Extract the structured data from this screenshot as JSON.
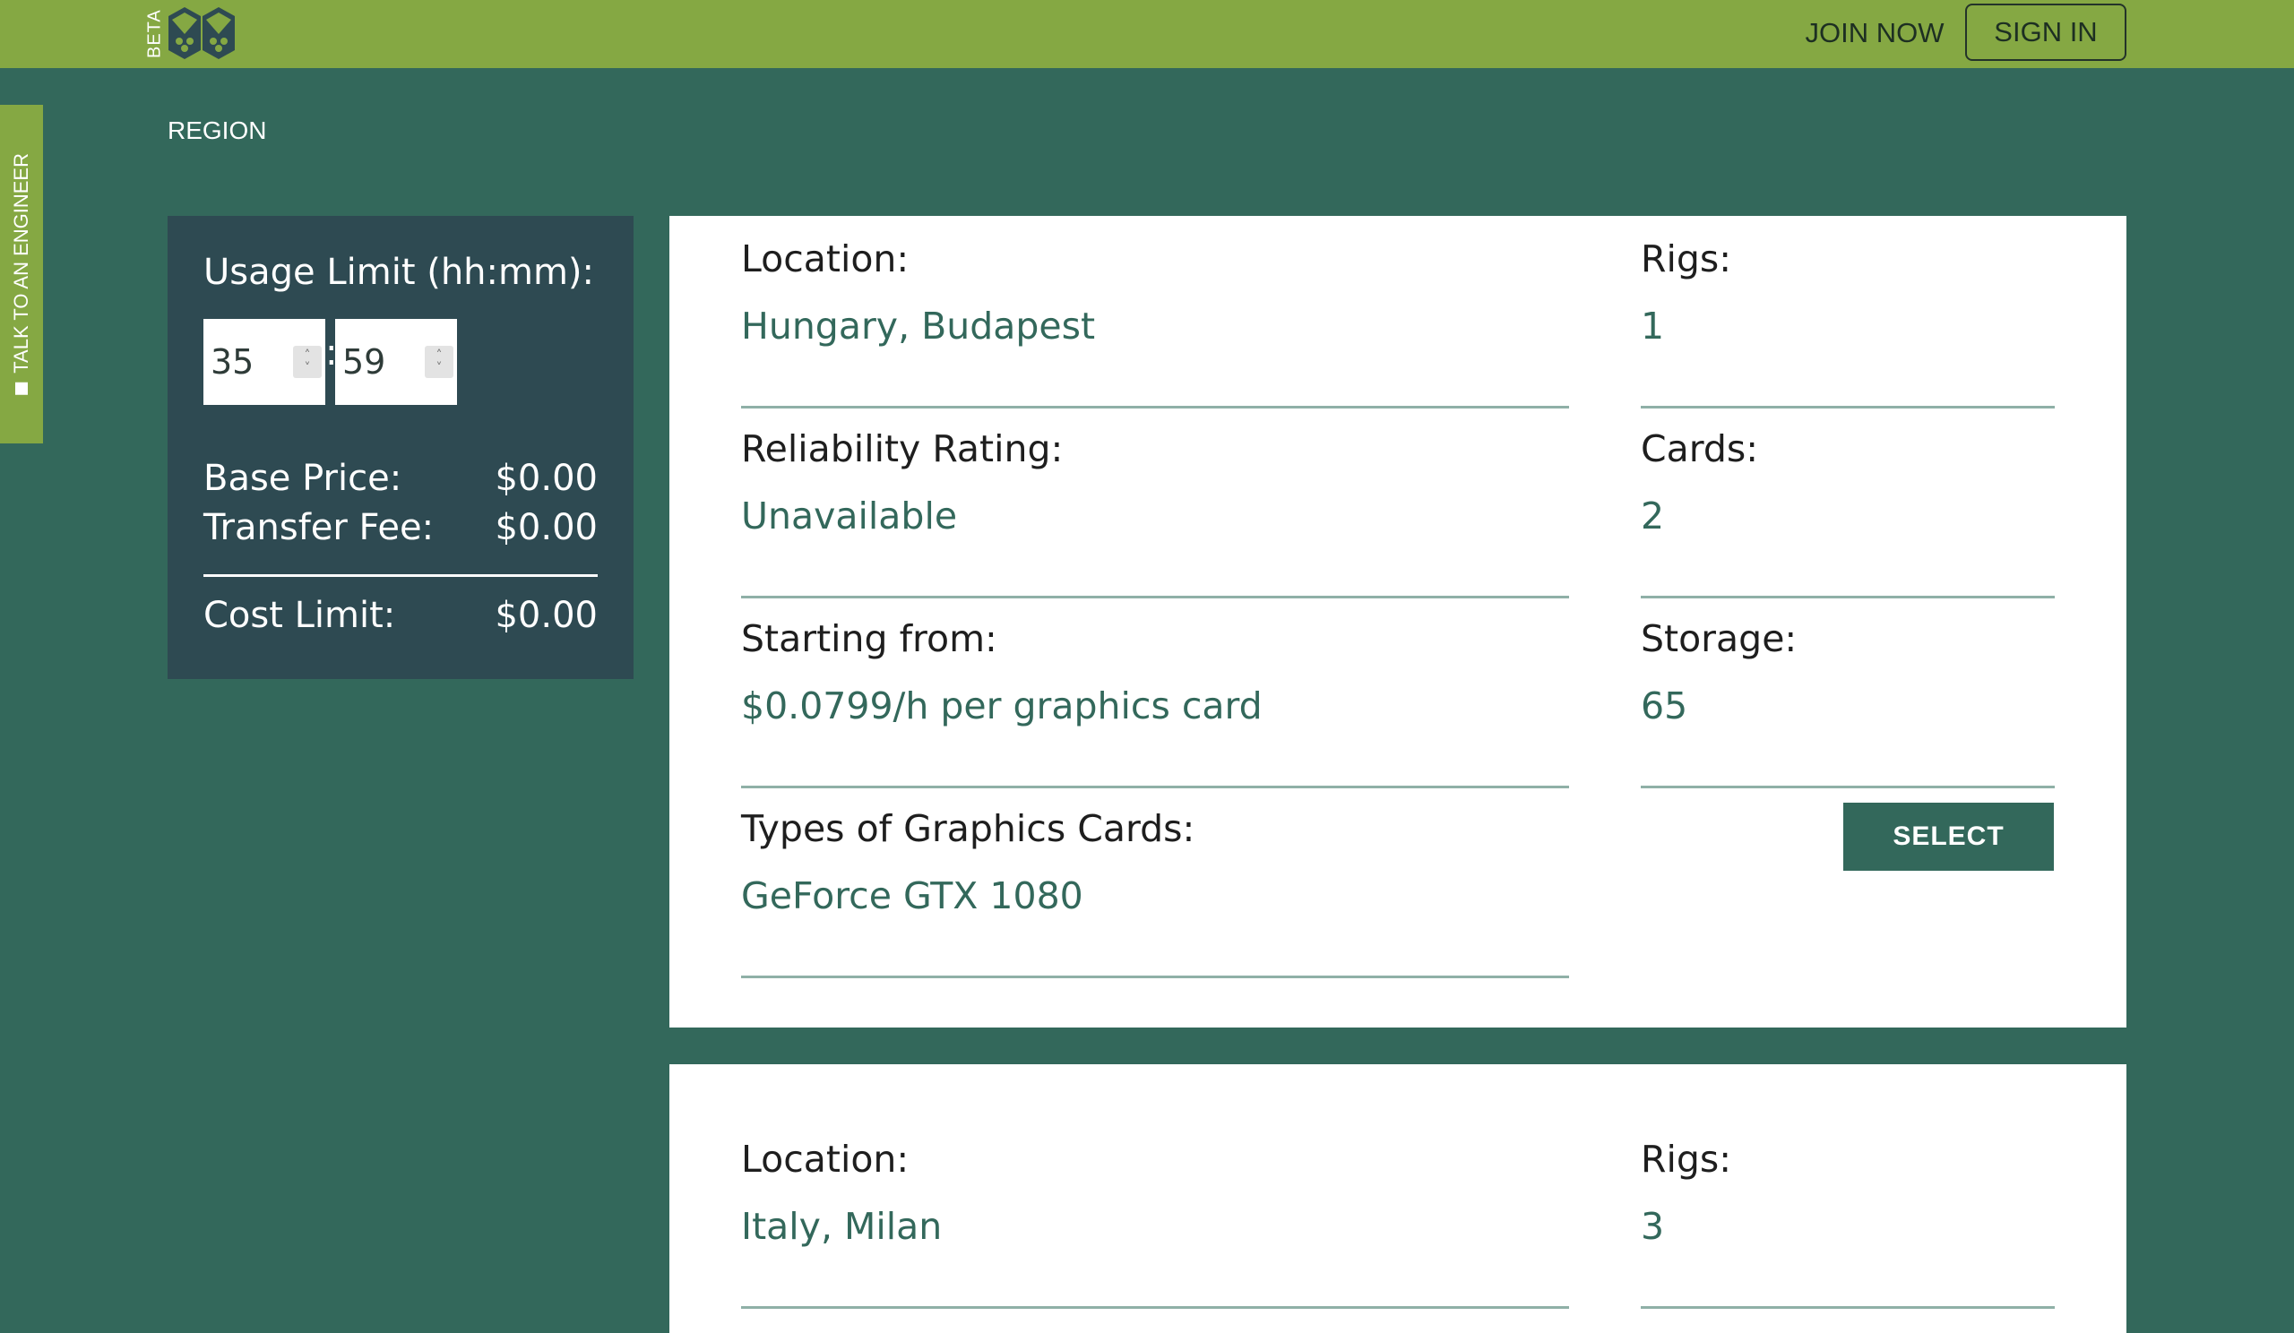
{
  "header": {
    "beta_label": "BETA",
    "join_now": "JOIN NOW",
    "sign_in": "SIGN IN",
    "colors": {
      "bar": "#85a843",
      "background": "#33685b"
    }
  },
  "side_tab": {
    "label": "TALK TO AN ENGINEER"
  },
  "region_label": "REGION",
  "usage": {
    "title": "Usage Limit (hh:mm):",
    "hours": "35",
    "minutes": "59",
    "separator": ":",
    "base_price_label": "Base Price:",
    "base_price_value": "$0.00",
    "transfer_fee_label": "Transfer Fee:",
    "transfer_fee_value": "$0.00",
    "cost_limit_label": "Cost Limit:",
    "cost_limit_value": "$0.00"
  },
  "offers": [
    {
      "location_label": "Location:",
      "location": "Hungary, Budapest",
      "rigs_label": "Rigs:",
      "rigs": "1",
      "reliability_label": "Reliability Rating:",
      "reliability": "Unavailable",
      "cards_label": "Cards:",
      "cards": "2",
      "starting_label": "Starting from:",
      "starting": "$0.0799/h per graphics card",
      "storage_label": "Storage:",
      "storage": "65",
      "types_label": "Types of Graphics Cards:",
      "types": "GeForce GTX 1080",
      "select_label": "SELECT"
    },
    {
      "location_label": "Location:",
      "location": "Italy, Milan",
      "rigs_label": "Rigs:",
      "rigs": "3"
    }
  ]
}
